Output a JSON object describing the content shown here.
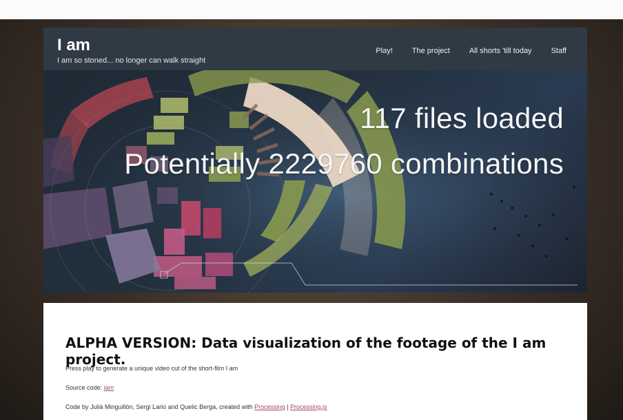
{
  "header": {
    "brand_title": "I am",
    "brand_subtitle": "I am so stoned... no longer can walk straight",
    "nav": [
      "Play!",
      "The project",
      "All shorts 'till today",
      "Staff"
    ]
  },
  "hero": {
    "line1": "117 files loaded",
    "line2": "Potentially 2229760 combinations"
  },
  "content": {
    "title": "ALPHA VERSION: Data visualization of the footage of the I am project.",
    "line1": "Press play to generate a unique video cut of the short-film I am",
    "line2_prefix": "Source code: ",
    "line2_link": "iam",
    "line3_prefix": "Code by Julià Minguillón, Sergi Lario and Quelic Berga, created with ",
    "line3_link1": "Processing",
    "line3_sep": " | ",
    "line3_link2": "Processing.js"
  },
  "colors": {
    "header_bg": "#2f3a44",
    "accent_link": "#a1495b"
  }
}
